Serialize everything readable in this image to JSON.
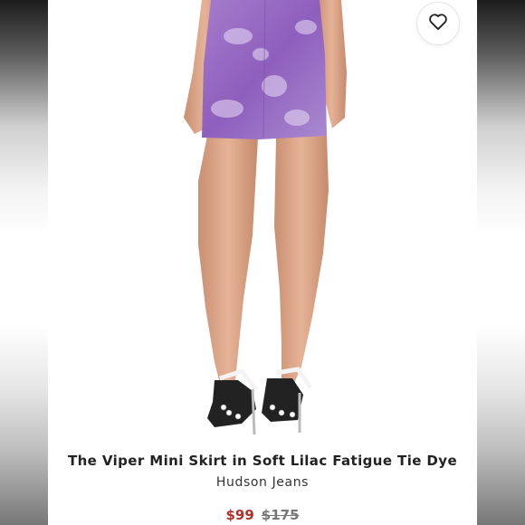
{
  "product": {
    "title": "The Viper Mini Skirt in Soft Lilac Fatigue Tie Dye",
    "brand": "Hudson Jeans",
    "sale_price": "$99",
    "original_price": "$175"
  },
  "icons": {
    "favorite": "heart-outline-icon"
  },
  "colors": {
    "sale_price": "#b0302a",
    "skirt": "#9a6cc0"
  }
}
